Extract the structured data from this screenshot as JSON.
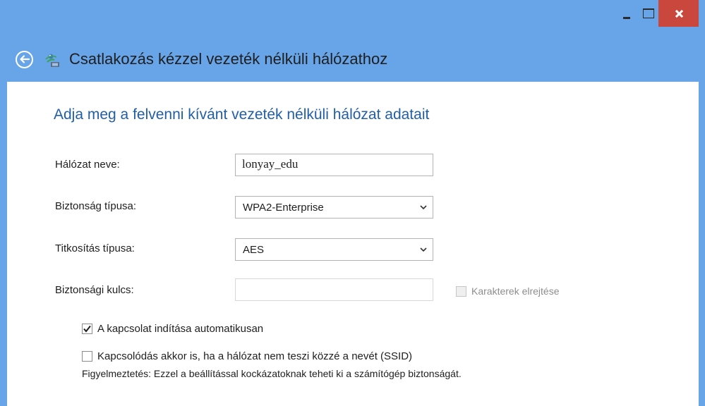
{
  "window": {
    "title": "Csatlakozás kézzel vezeték nélküli hálózathoz",
    "colors": {
      "frame": "#68a5e8",
      "close": "#c9473d",
      "accent_text": "#225ea8"
    }
  },
  "form": {
    "subtitle": "Adja meg a felvenni kívánt vezeték nélküli hálózat adatait",
    "network_name": {
      "label": "Hálózat neve:",
      "value": "lonyay_edu"
    },
    "security_type": {
      "label": "Biztonság típusa:",
      "selected": "WPA2-Enterprise"
    },
    "encryption_type": {
      "label": "Titkosítás típusa:",
      "selected": "AES"
    },
    "security_key": {
      "label": "Biztonsági kulcs:",
      "value": "",
      "disabled": true
    },
    "hide_characters": {
      "label": "Karakterek elrejtése",
      "checked": false,
      "disabled": true
    },
    "auto_connect": {
      "label": "A kapcsolat indítása automatikusan",
      "checked": true
    },
    "connect_hidden": {
      "label": "Kapcsolódás akkor is, ha a hálózat nem teszi közzé a nevét (SSID)",
      "checked": false
    },
    "warning": "Figyelmeztetés: Ezzel a beállítással kockázatoknak teheti ki a számítógép biztonságát."
  },
  "icons": {
    "back": "back-arrow-icon",
    "network": "wireless-network-icon",
    "minimize": "minimize-icon",
    "maximize": "maximize-icon",
    "close": "close-icon",
    "dropdown": "chevron-down-icon",
    "check": "checkmark-icon"
  }
}
